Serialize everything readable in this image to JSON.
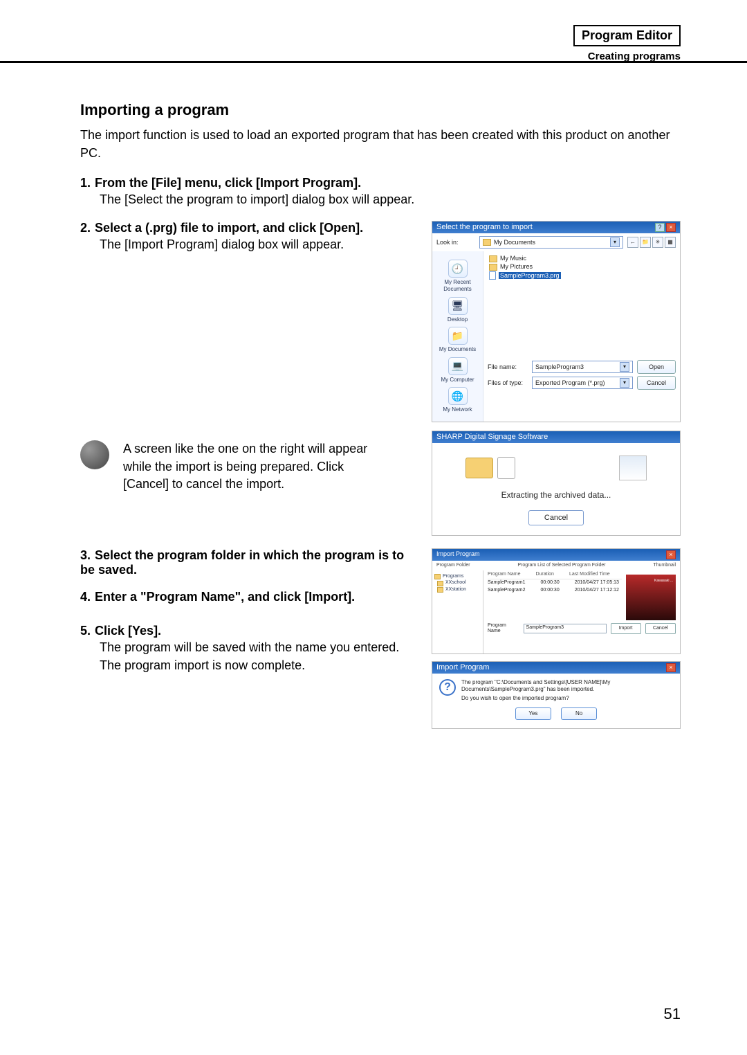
{
  "header": {
    "title": "Program Editor",
    "subtitle": "Creating programs"
  },
  "section": {
    "title": "Importing a program",
    "intro": "The import function is used to load an exported program that has been created with this product on another PC."
  },
  "steps": {
    "s1": {
      "no": "1.",
      "head": "From the [File] menu, click [Import Program].",
      "body": "The [Select the program to import] dialog box will appear."
    },
    "s2": {
      "no": "2.",
      "head": "Select a (.prg) file to import, and click [Open].",
      "body": "The [Import Program] dialog box will appear."
    },
    "s3": {
      "no": "3.",
      "head": "Select the program folder in which the program is to be saved."
    },
    "s4": {
      "no": "4.",
      "head": "Enter a \"Program Name\", and click [Import]."
    },
    "s5": {
      "no": "5.",
      "head": "Click [Yes].",
      "body1": "The program will be saved with the name you entered.",
      "body2": "The program import is now complete."
    }
  },
  "tip": "A screen like the one on the right will appear while the import is being prepared. Click [Cancel] to cancel the import.",
  "dlg_open": {
    "title": "Select the program to import",
    "lookin_label": "Look in:",
    "lookin_value": "My Documents",
    "files": {
      "f1": "My Music",
      "f2": "My Pictures",
      "f3": "SampleProgram3.prg"
    },
    "side": {
      "recent": "My Recent Documents",
      "desktop": "Desktop",
      "mydocs": "My Documents",
      "mycomp": "My Computer",
      "mynet": "My Network"
    },
    "filename_label": "File name:",
    "filename_value": "SampleProgram3",
    "filetype_label": "Files of type:",
    "filetype_value": "Exported Program (*.prg)",
    "open_btn": "Open",
    "cancel_btn": "Cancel"
  },
  "dlg_progress": {
    "title": "SHARP Digital Signage Software",
    "status": "Extracting the archived data...",
    "cancel": "Cancel"
  },
  "dlg_import": {
    "title": "Import Program",
    "folder_label": "Program Folder",
    "list_label": "Program List of Selected Program Folder",
    "thumb_label": "Thumbnail",
    "tree": {
      "root": "Programs",
      "t1": "XXschool",
      "t2": "XXstation"
    },
    "cols": {
      "c1": "Program Name",
      "c2": "Duration",
      "c3": "Last Modified Time"
    },
    "rows": {
      "r1": {
        "c1": "SampleProgram1",
        "c2": "00:00:30",
        "c3": "2010/04/27 17:05:13"
      },
      "r2": {
        "c1": "SampleProgram2",
        "c2": "00:00:30",
        "c3": "2010/04/27 17:12:12"
      }
    },
    "name_label": "Program Name",
    "name_value": "SampleProgram3",
    "import_btn": "Import",
    "cancel_btn": "Cancel"
  },
  "dlg_confirm": {
    "title": "Import Program",
    "msg1": "The program \"C:\\Documents and Settings\\[USER NAME]\\My Documents\\SampleProgram3.prg\" has been imported.",
    "msg2": "Do you wish to open the imported program?",
    "yes": "Yes",
    "no": "No"
  },
  "page_no": "51"
}
